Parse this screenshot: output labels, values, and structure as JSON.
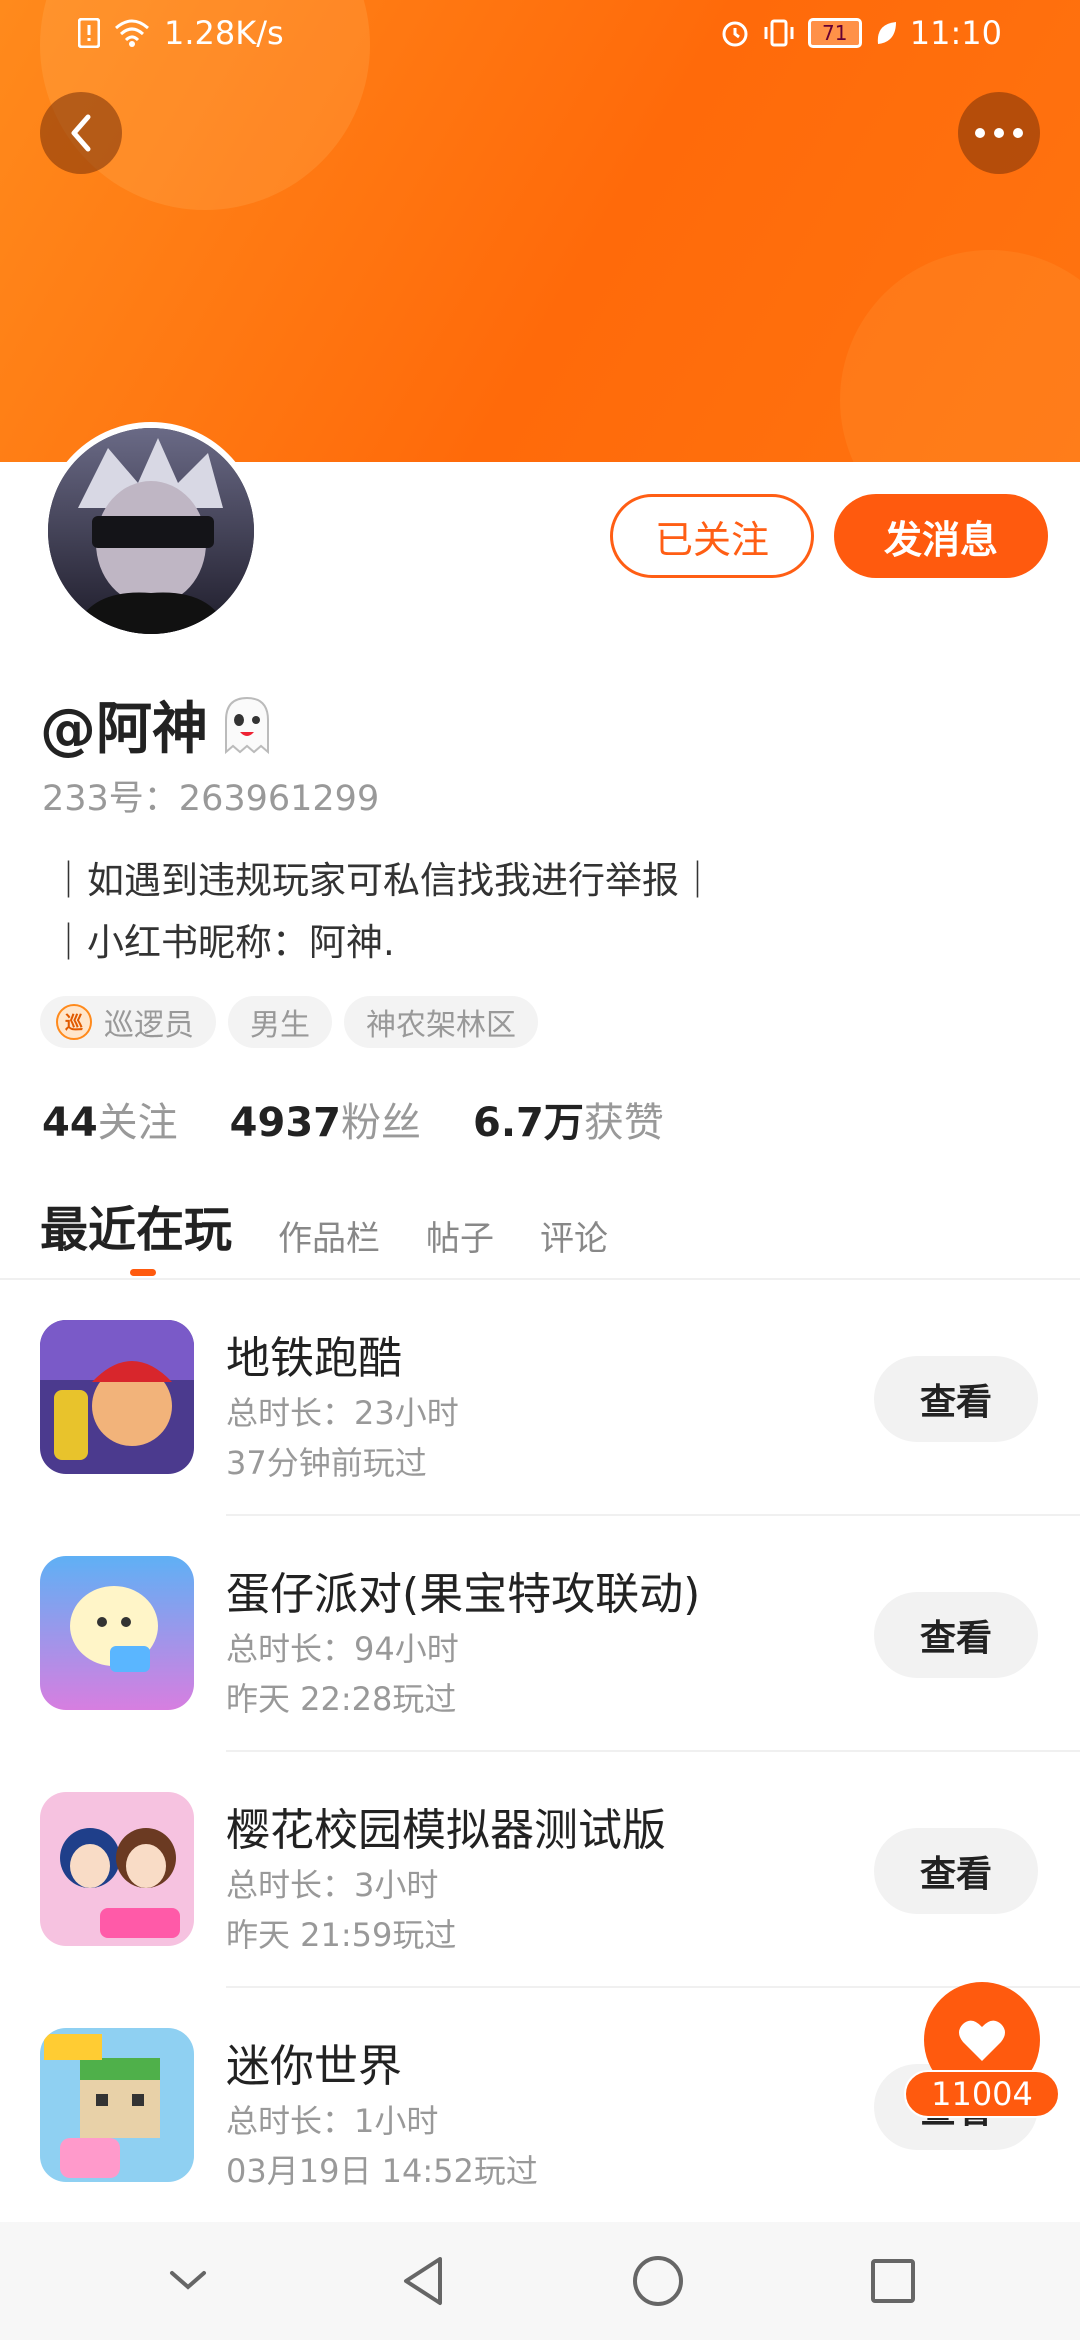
{
  "status_bar": {
    "net_speed": "1.28K/s",
    "battery": "71",
    "time": "11:10"
  },
  "header": {
    "back_icon": "chevron-left-icon",
    "more_icon": "more-dots-icon"
  },
  "profile": {
    "follow_label": "已关注",
    "message_label": "发消息",
    "nickname": "@阿神",
    "uid": "233号：263961299",
    "bio_lines": [
      "｜如遇到违规玩家可私信找我进行举报｜",
      "｜小红书昵称：阿神."
    ],
    "tags": [
      {
        "label": "巡逻员",
        "badge": "巡"
      },
      {
        "label": "男生"
      },
      {
        "label": "神农架林区"
      }
    ],
    "stats": [
      {
        "value": "44",
        "label": "关注"
      },
      {
        "value": "4937",
        "label": "粉丝"
      },
      {
        "value": "6.7万",
        "label": "获赞"
      }
    ]
  },
  "tabs": [
    "最近在玩",
    "作品栏",
    "帖子",
    "评论"
  ],
  "games": [
    {
      "title": "地铁跑酷",
      "duration": "总时长：23小时",
      "last_played": "37分钟前玩过",
      "button": "查看"
    },
    {
      "title": "蛋仔派对(果宝特攻联动)",
      "duration": "总时长：94小时",
      "last_played": "昨天 22:28玩过",
      "button": "查看"
    },
    {
      "title": "樱花校园模拟器测试版",
      "duration": "总时长：3小时",
      "last_played": "昨天 21:59玩过",
      "button": "查看"
    },
    {
      "title": "迷你世界",
      "duration": "总时长：1小时",
      "last_played": "03月19日 14:52玩过",
      "button": "查看"
    }
  ],
  "like": {
    "count": "11004"
  },
  "colors": {
    "accent": "#ff5a0e",
    "header": "#ff7410"
  }
}
